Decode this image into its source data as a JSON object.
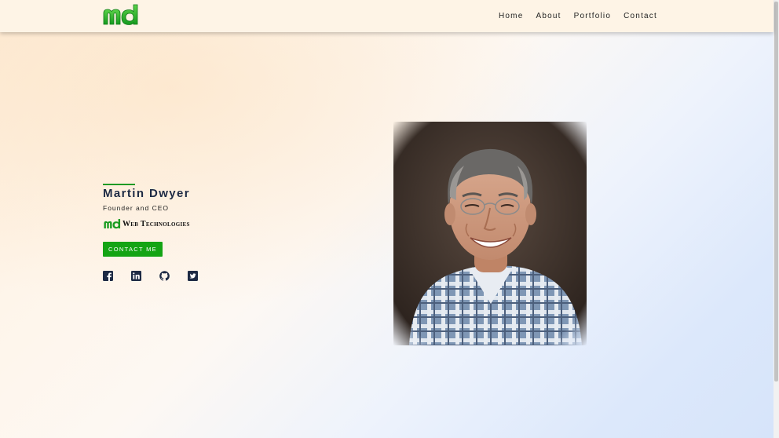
{
  "header": {
    "brand": "md",
    "nav": [
      "Home",
      "About",
      "Portfolio",
      "Contact"
    ]
  },
  "profile": {
    "name": "Martin Dwyer",
    "role": "Founder and CEO",
    "company_logo": "md",
    "company_name": "Web Technologies",
    "contact_button": "CONTACT ME",
    "social_icons": [
      "facebook-icon",
      "linkedin-icon",
      "github-icon",
      "twitter-icon"
    ],
    "portrait": "portrait-photo"
  },
  "colors": {
    "accent_green": "#14a414",
    "name_text": "#1d2a44",
    "navbar_bg": "#fef4e6"
  }
}
